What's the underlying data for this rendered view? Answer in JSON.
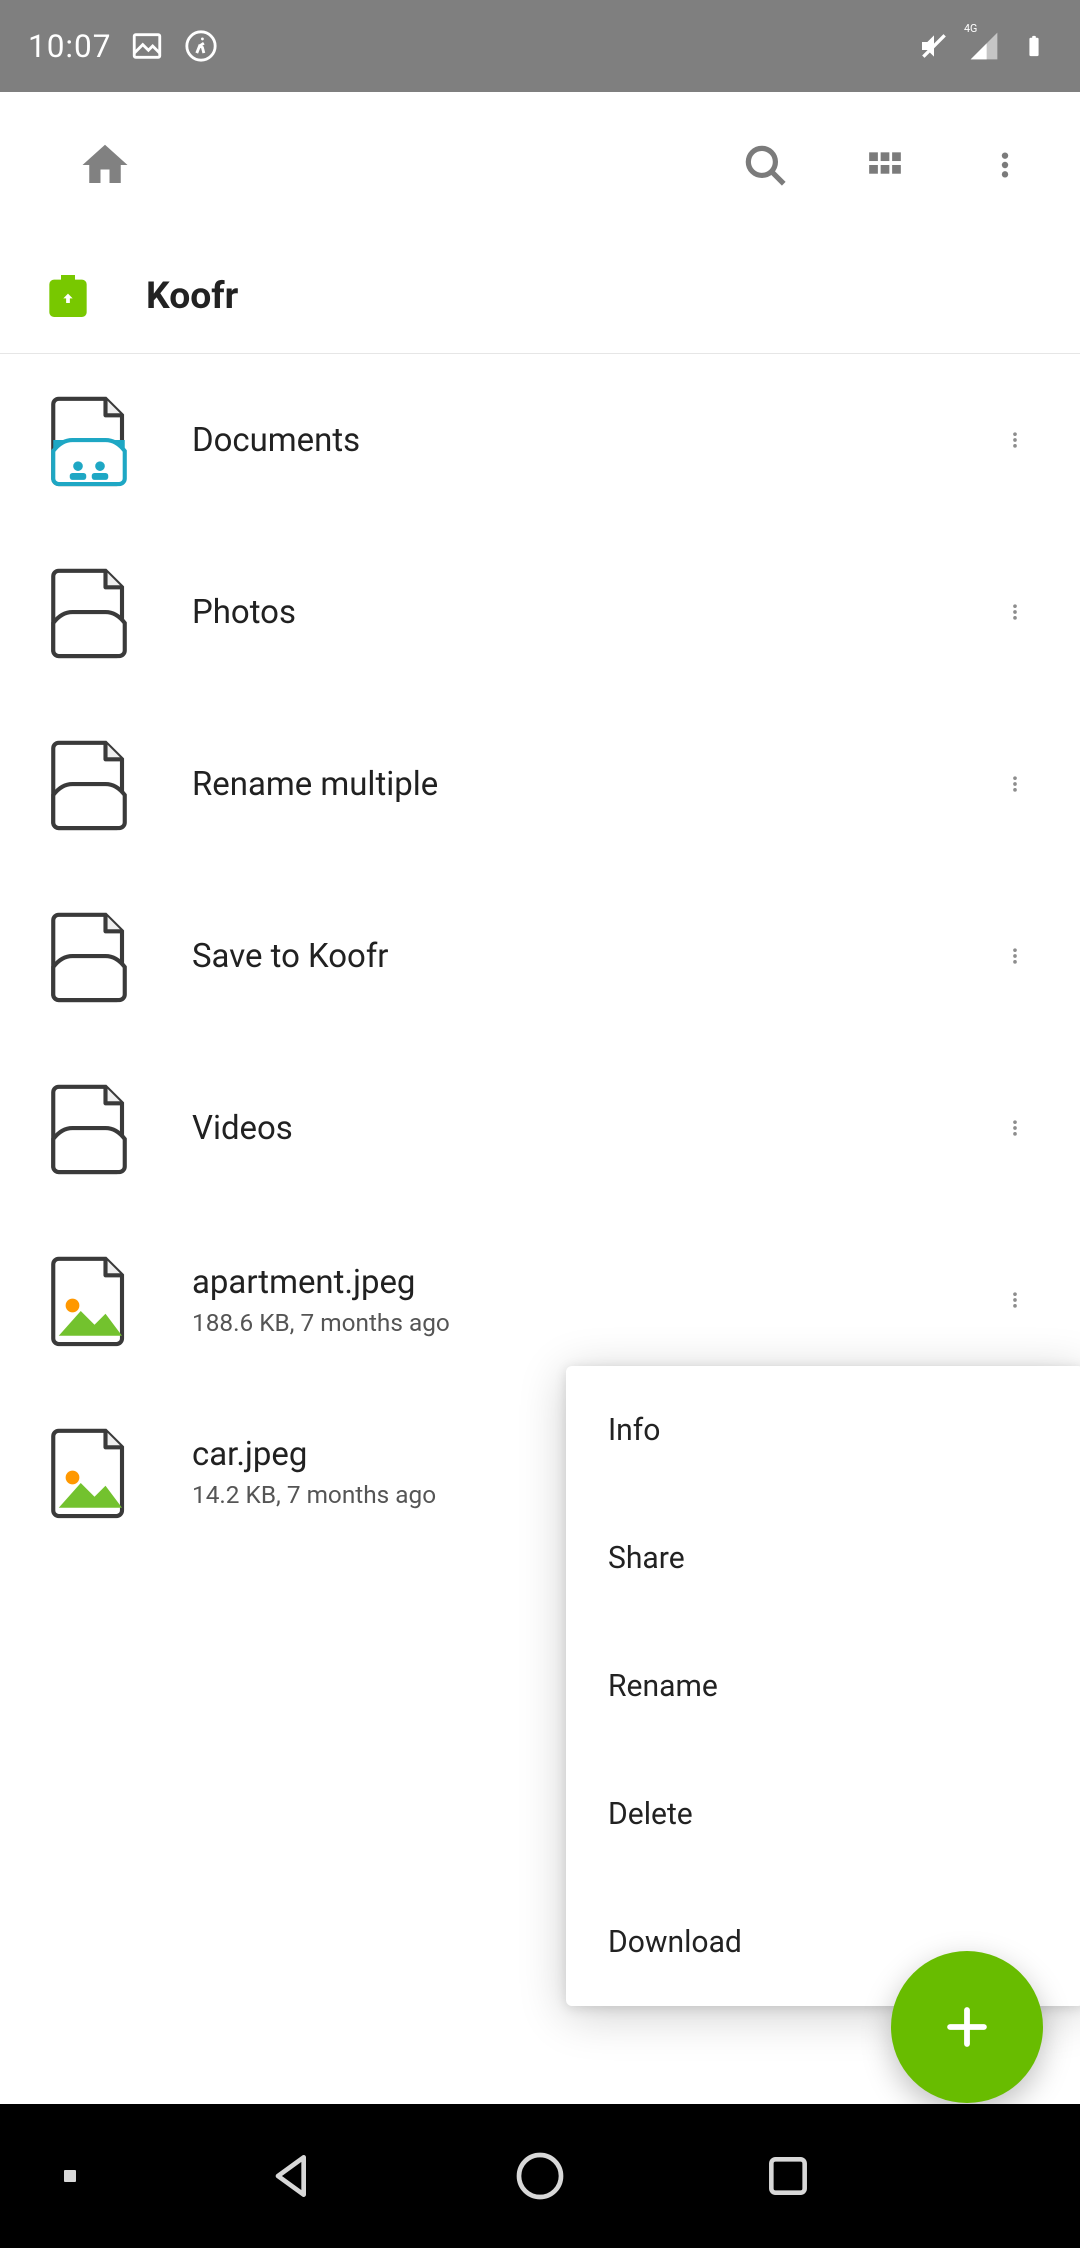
{
  "statusBar": {
    "time": "10:07",
    "networkLabel": "4G"
  },
  "toolbar": {},
  "breadcrumb": {
    "title": "Koofr"
  },
  "items": [
    {
      "iconType": "folder-special",
      "name": "Documents",
      "sub": ""
    },
    {
      "iconType": "folder",
      "name": "Photos",
      "sub": ""
    },
    {
      "iconType": "folder",
      "name": "Rename multiple",
      "sub": ""
    },
    {
      "iconType": "folder",
      "name": "Save to Koofr",
      "sub": ""
    },
    {
      "iconType": "folder",
      "name": "Videos",
      "sub": ""
    },
    {
      "iconType": "image",
      "name": "apartment.jpeg",
      "sub": "188.6 KB, 7 months ago"
    },
    {
      "iconType": "image",
      "name": "car.jpeg",
      "sub": "14.2 KB, 7 months ago"
    }
  ],
  "contextMenu": {
    "items": [
      {
        "label": "Info"
      },
      {
        "label": "Share"
      },
      {
        "label": "Rename"
      },
      {
        "label": "Delete"
      },
      {
        "label": "Download"
      }
    ]
  },
  "colors": {
    "accent": "#68bc00",
    "folderStroke": "#3a3a3a"
  }
}
